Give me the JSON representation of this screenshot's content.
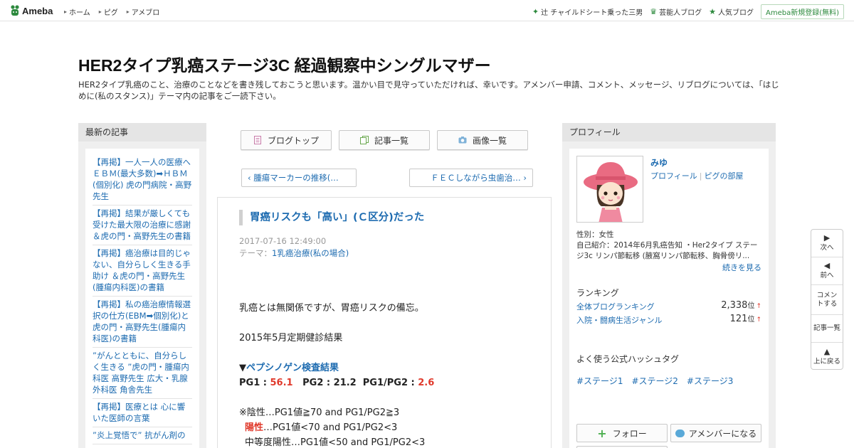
{
  "topbar": {
    "logo_text": "Ameba",
    "nav": [
      "ホーム",
      "ピグ",
      "アメブロ"
    ],
    "right_items": [
      {
        "icon": "sparkle-icon",
        "label": "辻 チャイルドシート乗った三男"
      },
      {
        "icon": "crown-icon",
        "label": "芸能人ブログ"
      },
      {
        "icon": "star-icon",
        "label": "人気ブログ"
      }
    ],
    "register_label": "Ameba新規登録(無料)"
  },
  "header": {
    "title": "HER2タイプ乳癌ステージ3C 経過観察中シングルマザー",
    "description": "HER2タイプ乳癌のこと、治療のことなどを書き残しておこうと思います。温かい目で見守っていただければ、幸いです。アメンバー申請、コメント、メッセージ、リブログについては、「はじめに(私のスタンス)」テーマ内の記事をご一読下さい。"
  },
  "left": {
    "header": "最新の記事",
    "items": [
      "【再掲】一人一人の医療へ ＥＢＭ(最大多数)➡ＨＢＭ(個別化) 虎の門病院・高野先生",
      "【再掲】結果が厳しくても受けた最大限の治療に感謝 ＆虎の門・高野先生の書籍",
      "【再掲】癌治療は目的じゃない、自分らしく生きる手助け ＆虎の門・高野先生(腫瘍内科医)の書籍",
      "【再掲】私の癌治療情報選択の仕方(EBM➡個別化)と虎の門・高野先生(腫瘍内科医)の書籍",
      "”がんとともに、自分らしく生きる ”虎の門・腫瘍内科医 高野先生 広大・乳腺外科医 角舎先生",
      "【再掲】医療とは 心に響いた医師の言葉",
      "”炎上覚悟で” 抗がん剤の"
    ]
  },
  "center": {
    "buttons": [
      {
        "icon": "blog-top-icon",
        "label": "ブログトップ"
      },
      {
        "icon": "article-list-icon",
        "label": "記事一覧"
      },
      {
        "icon": "camera-icon",
        "label": "画像一覧"
      }
    ],
    "prev_label": "‹ 腫瘍マーカーの推移(…",
    "next_label": "ＦＥＣしながら虫歯治… ›",
    "article": {
      "title": "胃癌リスクも「高い」(Ｃ区分)だった",
      "date": "2017-07-16 12:49:00",
      "theme_prefix": "テーマ：",
      "theme": "1乳癌治療(私の場合)",
      "p1": "乳癌とは無関係ですが、胃癌リスクの備忘。",
      "p2": "2015年5月定期健診結果",
      "heading_marker": "▼",
      "heading": "ペプシノゲン検査結果",
      "pg1_label": "PG1 : ",
      "pg1_value": "56.1",
      "pg2_text": "   PG2 : 21.2  PG1/PG2 : ",
      "ratio_value": "2.6",
      "neg_line": "※陰性…PG1値≧70 and PG1/PG2≧3",
      "pos_label": "陽性",
      "pos_line": "…PG1値<70 and PG1/PG2<3",
      "mid_line": "中等度陽性…PG1値<50 and PG1/PG2<3"
    }
  },
  "right": {
    "header": "プロフィール",
    "name": "みゆ",
    "link_profile": "プロフィール",
    "link_room": "ピグの部屋",
    "gender": "性別：女性",
    "intro": "自己紹介：2014年6月乳癌告知 ・Her2タイプ ステージ3c リンパ節転移 (腋窩リンパ節転移、胸骨傍リ...",
    "read_more": "続きを見る",
    "ranking_title": "ランキング",
    "rankings": [
      {
        "label": "全体ブログランキング",
        "value": "2,338",
        "unit": "位",
        "trend": "↑"
      },
      {
        "label": "入院・闘病生活ジャンル",
        "value": "121",
        "unit": "位",
        "trend": "↑"
      }
    ],
    "hashtag_title": "よく使う公式ハッシュタグ",
    "hashtags": [
      "#ステージ1",
      "#ステージ2",
      "#ステージ3"
    ],
    "follow_label": "フォロー",
    "member_label": "アメンバーになる"
  },
  "sidenav": [
    {
      "icon": "next-icon",
      "label": "次へ"
    },
    {
      "icon": "prev-icon",
      "label": "前へ"
    },
    {
      "icon": "",
      "label": "コメントする"
    },
    {
      "icon": "",
      "label": "記事一覧"
    },
    {
      "icon": "top-icon",
      "label": "上に戻る"
    }
  ],
  "colors": {
    "link": "#1d6bb0",
    "accent_green": "#2d8a3e",
    "emphasis_red": "#e0392b"
  }
}
